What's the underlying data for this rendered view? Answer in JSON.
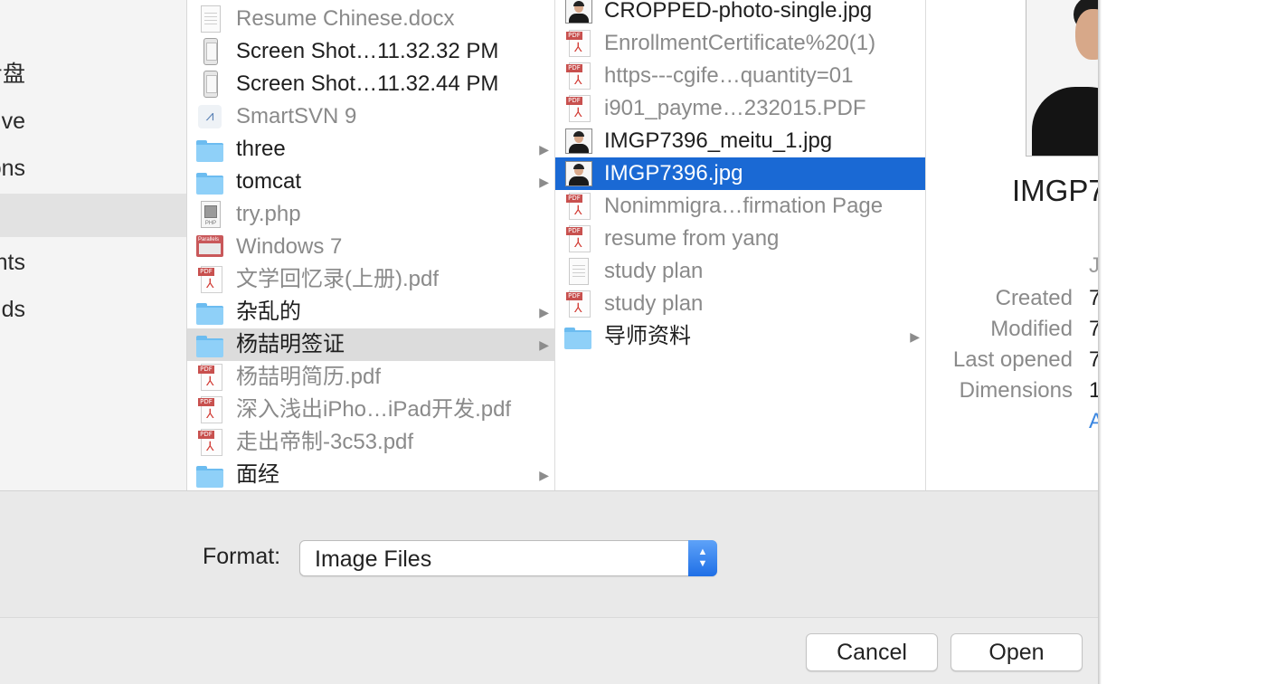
{
  "sidebar": {
    "items": [
      {
        "label": "步盘",
        "active": false
      },
      {
        "label": "rive",
        "active": false
      },
      {
        "label": "ons",
        "active": false
      },
      {
        "label": "",
        "active": true
      },
      {
        "label": "nts",
        "active": false
      },
      {
        "label": "ds",
        "active": false
      }
    ]
  },
  "column1": {
    "items": [
      {
        "name": "Resume Chinese.docx",
        "icon": "document-icon",
        "dim": true
      },
      {
        "name": "Screen Shot…11.32.32 PM",
        "icon": "screenshot-icon"
      },
      {
        "name": "Screen Shot…11.32.44 PM",
        "icon": "screenshot-icon"
      },
      {
        "name": "SmartSVN 9",
        "icon": "app-icon",
        "dim": true
      },
      {
        "name": "three",
        "icon": "folder-icon",
        "folder": true
      },
      {
        "name": "tomcat",
        "icon": "folder-icon",
        "folder": true
      },
      {
        "name": "try.php",
        "icon": "php-file-icon",
        "dim": true
      },
      {
        "name": "Windows 7",
        "icon": "vm-icon",
        "dim": true
      },
      {
        "name": "文学回忆录(上册).pdf",
        "icon": "pdf-icon",
        "dim": true
      },
      {
        "name": "杂乱的",
        "icon": "folder-icon",
        "folder": true
      },
      {
        "name": "杨喆明签证",
        "icon": "folder-icon",
        "folder": true,
        "selected": true
      },
      {
        "name": "杨喆明简历.pdf",
        "icon": "pdf-icon",
        "dim": true
      },
      {
        "name": "深入浅出iPho…iPad开发.pdf",
        "icon": "pdf-icon",
        "dim": true
      },
      {
        "name": "走出帝制-3c53.pdf",
        "icon": "pdf-icon",
        "dim": true
      },
      {
        "name": "面经",
        "icon": "folder-icon",
        "folder": true
      }
    ]
  },
  "column2": {
    "items": [
      {
        "name": "CROPPED-photo-single.jpg",
        "icon": "photo-icon"
      },
      {
        "name": "EnrollmentCertificate%20(1)",
        "icon": "pdf-icon",
        "dim": true
      },
      {
        "name": "https---cgife…quantity=01",
        "icon": "pdf-icon",
        "dim": true
      },
      {
        "name": "i901_payme…232015.PDF",
        "icon": "pdf-icon",
        "dim": true
      },
      {
        "name": "IMGP7396_meitu_1.jpg",
        "icon": "photo-icon"
      },
      {
        "name": "IMGP7396.jpg",
        "icon": "photo-icon",
        "selected": true
      },
      {
        "name": "Nonimmigra…firmation Page",
        "icon": "pdf-icon",
        "dim": true
      },
      {
        "name": "resume from yang",
        "icon": "pdf-icon",
        "dim": true
      },
      {
        "name": "study plan",
        "icon": "document-icon",
        "dim": true
      },
      {
        "name": "study plan",
        "icon": "pdf-icon",
        "dim": true
      },
      {
        "name": "导师资料",
        "icon": "folder-icon",
        "folder": true
      }
    ]
  },
  "preview": {
    "title": "IMGP7",
    "kind_partial": "J",
    "labels": {
      "created": "Created",
      "modified": "Modified",
      "last_opened": "Last opened",
      "dimensions": "Dimensions"
    },
    "values": {
      "created": "7",
      "modified": "7",
      "last_opened": "7",
      "dimensions": "1"
    },
    "link_partial": "A"
  },
  "format": {
    "label": "Format:",
    "selected": "Image Files"
  },
  "buttons": {
    "cancel": "Cancel",
    "open": "Open"
  },
  "colors": {
    "selection_blue": "#1a69d4",
    "selection_gray": "#dcdcdc",
    "accent": "#3b86e0"
  }
}
